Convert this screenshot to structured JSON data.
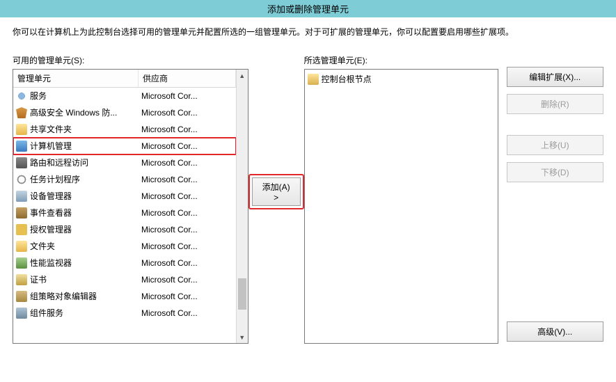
{
  "window": {
    "title": "添加或删除管理单元"
  },
  "instructions": "你可以在计算机上为此控制台选择可用的管理单元并配置所选的一组管理单元。对于可扩展的管理单元，你可以配置要启用哪些扩展项。",
  "available": {
    "label": "可用的管理单元(S):",
    "columns": {
      "name": "管理单元",
      "vendor": "供应商"
    },
    "items": [
      {
        "name": "服务",
        "vendor": "Microsoft Cor...",
        "icon": "ic-gear"
      },
      {
        "name": "高级安全 Windows 防...",
        "vendor": "Microsoft Cor...",
        "icon": "ic-shield"
      },
      {
        "name": "共享文件夹",
        "vendor": "Microsoft Cor...",
        "icon": "ic-folder"
      },
      {
        "name": "计算机管理",
        "vendor": "Microsoft Cor...",
        "icon": "ic-comp",
        "highlighted": true
      },
      {
        "name": "路由和远程访问",
        "vendor": "Microsoft Cor...",
        "icon": "ic-net"
      },
      {
        "name": "任务计划程序",
        "vendor": "Microsoft Cor...",
        "icon": "ic-clock"
      },
      {
        "name": "设备管理器",
        "vendor": "Microsoft Cor...",
        "icon": "ic-device"
      },
      {
        "name": "事件查看器",
        "vendor": "Microsoft Cor...",
        "icon": "ic-event"
      },
      {
        "name": "授权管理器",
        "vendor": "Microsoft Cor...",
        "icon": "ic-key"
      },
      {
        "name": "文件夹",
        "vendor": "Microsoft Cor...",
        "icon": "ic-folder"
      },
      {
        "name": "性能监视器",
        "vendor": "Microsoft Cor...",
        "icon": "ic-perf"
      },
      {
        "name": "证书",
        "vendor": "Microsoft Cor...",
        "icon": "ic-cert"
      },
      {
        "name": "组策略对象编辑器",
        "vendor": "Microsoft Cor...",
        "icon": "ic-gp"
      },
      {
        "name": "组件服务",
        "vendor": "Microsoft Cor...",
        "icon": "ic-components"
      }
    ]
  },
  "buttons": {
    "add": "添加(A) >",
    "edit_extensions": "编辑扩展(X)...",
    "remove": "删除(R)",
    "move_up": "上移(U)",
    "move_down": "下移(D)",
    "advanced": "高级(V)..."
  },
  "selected": {
    "label": "所选管理单元(E):",
    "root": "控制台根节点"
  }
}
